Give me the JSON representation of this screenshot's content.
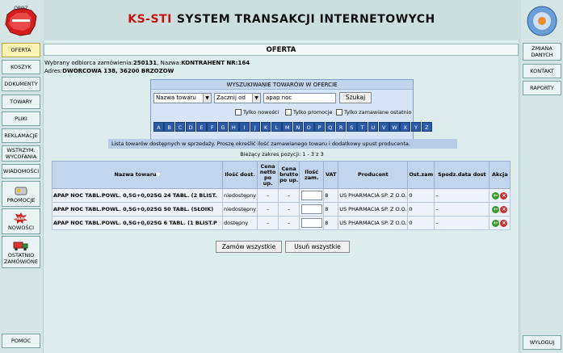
{
  "header": {
    "brand": "KS-STI",
    "title": "SYSTEM TRANSAKCJI INTERNETOWYCH"
  },
  "logo": {
    "text": "OBOZ",
    "icon": "poland-map-logo"
  },
  "left_nav": [
    {
      "label": "OFERTA",
      "active": true
    },
    {
      "label": "KOSZYK"
    },
    {
      "label": "DOKUMENTY"
    },
    {
      "label": "TOWARY"
    },
    {
      "label": "PLIKI"
    },
    {
      "label": "REKLAMACJE"
    },
    {
      "label": "WSTRZYM. WYCOFANIA"
    },
    {
      "label": "WIADOMOŚCI"
    },
    {
      "label": "PROMOCJE",
      "icon": "promo-icon"
    },
    {
      "label": "NOWOŚCI",
      "icon": "new-badge-icon",
      "badge": "NEW!"
    },
    {
      "label": "OSTATNIO ZAMÓWIONE",
      "icon": "truck-icon"
    },
    {
      "label": "POMOC"
    }
  ],
  "right_nav": [
    {
      "label": "ZMIANA DANYCH"
    },
    {
      "label": "KONTAKT"
    },
    {
      "label": "RAPORTY"
    },
    {
      "label": "WYLOGUJ"
    }
  ],
  "page": {
    "title": "OFERTA",
    "recipient_label": "Wybrany odbiorca zamówienia:",
    "recipient_id": "250131",
    "name_label": ", Nazwa:",
    "recipient_name": "KONTRAHENT NR:164",
    "address_label": "Adres:",
    "address": "DWORCOWA 138, 36200 BRZOZOW"
  },
  "search": {
    "title": "WYSZUKIWANIE TOWARÓW W OFERCIE",
    "field_select": "Nazwa towaru",
    "mode_select": "Zacznij od",
    "query": "apap noc",
    "search_button": "Szukaj",
    "check_new": "Tylko nowości",
    "check_promo": "Tylko promocje",
    "check_recent": "Tylko zamawiane ostatnio",
    "letters": [
      "A",
      "B",
      "C",
      "D",
      "E",
      "F",
      "G",
      "H",
      "I",
      "J",
      "K",
      "L",
      "M",
      "N",
      "O",
      "P",
      "Q",
      "R",
      "S",
      "T",
      "U",
      "V",
      "W",
      "X",
      "Y",
      "Z"
    ]
  },
  "note": "Lista towarów dostępnych w sprzedaży. Proszę określić ilość zamawianego towaru i dodatkowy upust producenta.",
  "range": "Bieżący zakres pozycji: 1 - 3 z 3",
  "table": {
    "headers": [
      "Nazwa towaru",
      "Ilość dost.",
      "Cena netto po up.",
      "Cena brutto po up.",
      "Ilość zam.",
      "VAT",
      "Producent",
      "Ost.zam",
      "Spodz.data dost",
      "Akcja"
    ],
    "sort_indicator": "▼",
    "rows": [
      {
        "name": "APAP NOC TABL.POWL. 0,5G+0,025G 24 TABL. (2 BLIST.",
        "avail": "niedostępny",
        "net": "–",
        "gross": "–",
        "vat": "8",
        "producer": "US PHARMACIA SP. Z O.O.",
        "last": "0",
        "expected": "–"
      },
      {
        "name": "APAP NOC TABL.POWL. 0,5G+0,025G 50 TABL. (SŁOIK)",
        "avail": "niedostępny",
        "net": "–",
        "gross": "–",
        "vat": "8",
        "producer": "US PHARMACIA SP. Z O.O.",
        "last": "0",
        "expected": "–"
      },
      {
        "name": "APAP NOC TABL.POWL. 0,5G+0,025G 6 TABL. (1 BLIST.P",
        "avail": "dostępny",
        "net": "–",
        "gross": "–",
        "vat": "8",
        "producer": "US PHARMACIA SP. Z O.O.",
        "last": "0",
        "expected": "–"
      }
    ]
  },
  "buttons": {
    "order_all": "Zamów wszystkie",
    "remove_all": "Usuń wszystkie"
  },
  "colors": {
    "brand_red": "#cc1111",
    "letter_blue": "#2b5aa6",
    "active_nav": "#fcf3b4"
  }
}
